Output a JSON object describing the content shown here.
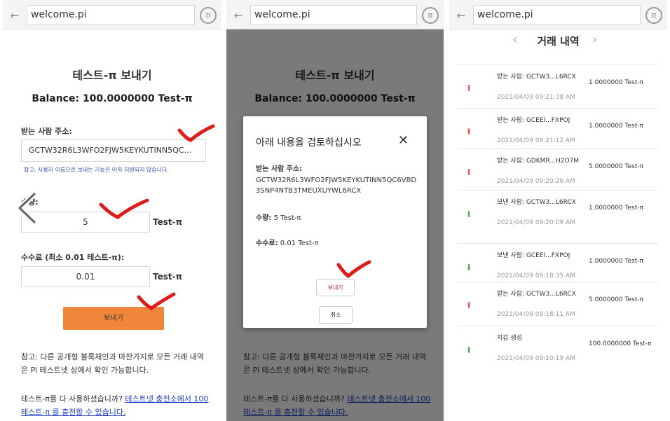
{
  "browser": {
    "url": "welcome.pi",
    "back_icon": "←",
    "pi_icon": "π"
  },
  "send_form": {
    "title": "테스트-π 보내기",
    "balance": "Balance: 100.0000000 Test-π",
    "recipient_label": "받는 사람 주소:",
    "recipient_value": "GCTW32R6L3WFO2FJW5KEYKUTINN5QC...",
    "recipient_hint": "참고: 사용자 이름으로 보내는 기능은 아직 지원되지 않습니다.",
    "amount_label": "수량:",
    "amount_value": "5",
    "amount_unit": "Test-π",
    "fee_label": "수수료 (최소 0.01 테스트-π):",
    "fee_value": "0.01",
    "fee_unit": "Test-π",
    "send_button": "보내기",
    "note": "참고: 다른 공개형 블록체인과 마찬가지로 모든 거래 내역은 Pi 테스트넷 상에서 확인 가능합니다.",
    "faucet_prefix": "테스트-π를 다 사용하셨습니까? ",
    "faucet_link": "테스트넷 충전소에서 100 테스트-π 를 충전할 수 있습니다."
  },
  "confirm_dialog": {
    "title": "아래 내용을 검토하십시오",
    "close_icon": "✕",
    "recipient_label": "받는 사람 주소:",
    "recipient_full": "GCTW32R6L3WFO2FJW5KEYKUTINN5QC6VBD3SNP4NTB3TMEUXUYWL6RCX",
    "amount_label": "수량:",
    "amount_value": " 5 Test-π",
    "fee_label": "수수료:",
    "fee_value": " 0.01 Test-π",
    "confirm_button": "보내기",
    "cancel_button": "취소"
  },
  "history": {
    "title": "거래 내역",
    "prev_icon": "‹",
    "next_icon": "›",
    "rows": [
      {
        "direction": "out",
        "party": "받는 사람: GCTW3...L6RCX",
        "time": "2021/04/09 09:21:38 AM",
        "amount": "1.0000000 Test-π"
      },
      {
        "direction": "out",
        "party": "받는 사람: GCEEI...FXPOJ",
        "time": "2021/04/09 09:21:12 AM",
        "amount": "1.0000000 Test-π"
      },
      {
        "direction": "out",
        "party": "받는 사람: GDKMR...H2O7M",
        "time": "2021/04/09 09:20:20 AM",
        "amount": "5.0000000 Test-π"
      },
      {
        "direction": "in",
        "party": "보낸 사람: GCTW3...L6RCX",
        "time": "2021/04/09 09:20:09 AM",
        "amount": "1.0000000 Test-π"
      },
      {
        "direction": "in",
        "party": "보낸 사람: GCEEI...FXPOJ",
        "time": "2021/04/09 09:18:35 AM",
        "amount": "1.0000000 Test-π"
      },
      {
        "direction": "out",
        "party": "받는 사람: GCTW3...L6RCX",
        "time": "2021/04/09 09:18:11 AM",
        "amount": "5.0000000 Test-π"
      },
      {
        "direction": "in",
        "party": "지갑 생성",
        "time": "2021/04/09 09:10:19 AM",
        "amount": "100.0000000 Test-π"
      }
    ],
    "colors": {
      "out": "#e53935",
      "in": "#2e9a3a"
    },
    "icons": {
      "out": "upload-arrow-icon",
      "in": "download-arrow-icon"
    }
  },
  "colors": {
    "send_button": "#f0863a",
    "link": "#1a3cc8",
    "checkmark": "#e11a1a"
  }
}
